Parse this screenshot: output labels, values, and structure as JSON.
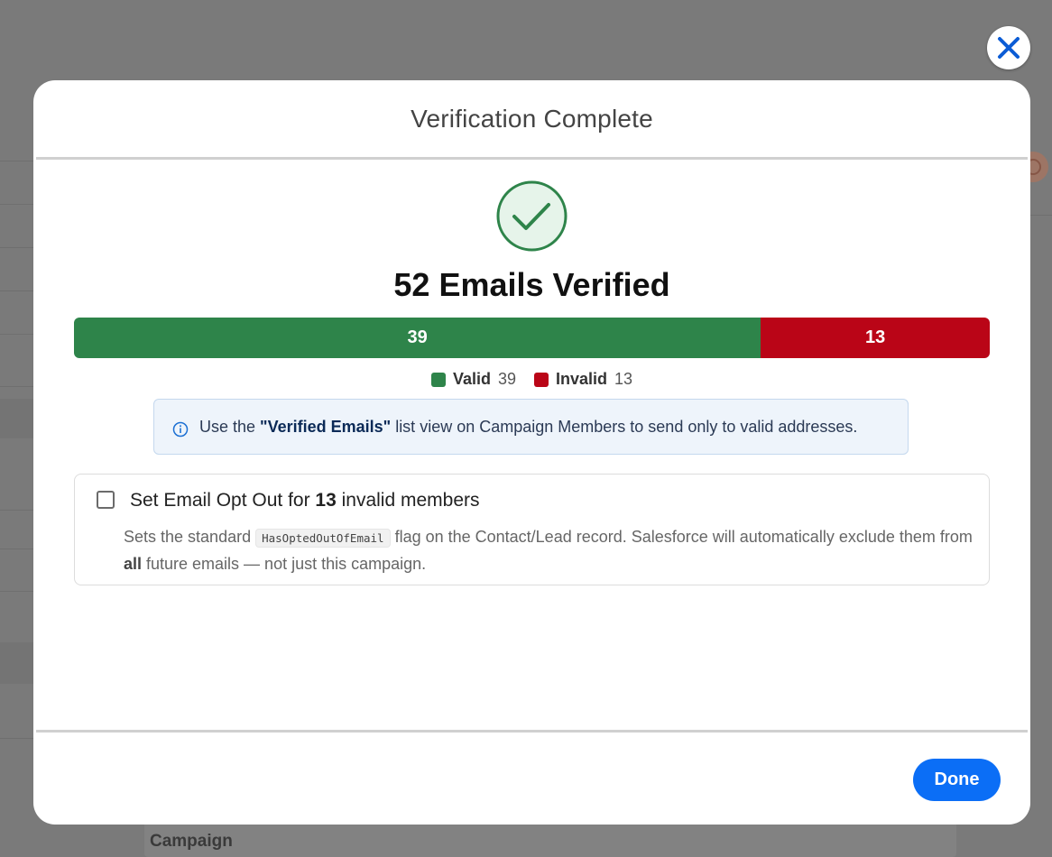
{
  "modal": {
    "title": "Verification Complete",
    "headline": "52 Emails Verified",
    "close_icon": "close-icon",
    "success_icon": "check-circle-icon"
  },
  "verification": {
    "total": 52,
    "valid": 39,
    "invalid": 13,
    "valid_label": "Valid",
    "invalid_label": "Invalid",
    "valid_color": "#2e844a",
    "invalid_color": "#ba0517"
  },
  "info": {
    "icon": "info-icon",
    "prefix": "Use the ",
    "emphasis": "\"Verified Emails\"",
    "suffix": " list view on Campaign Members to send only to valid addresses."
  },
  "optout": {
    "checked": false,
    "label_prefix": "Set Email Opt Out for ",
    "label_count": "13",
    "label_suffix": " invalid members",
    "desc_prefix": "Sets the standard ",
    "desc_code": "HasOptedOutOfEmail",
    "desc_middle": " flag on the Contact/Lead record. Salesforce will automatically exclude them from ",
    "desc_bold": "all",
    "desc_suffix": " future emails — not just this campaign."
  },
  "footer": {
    "done_label": "Done",
    "accent_color": "#0b6ef6"
  },
  "background": {
    "visible_text": "Campaign"
  }
}
